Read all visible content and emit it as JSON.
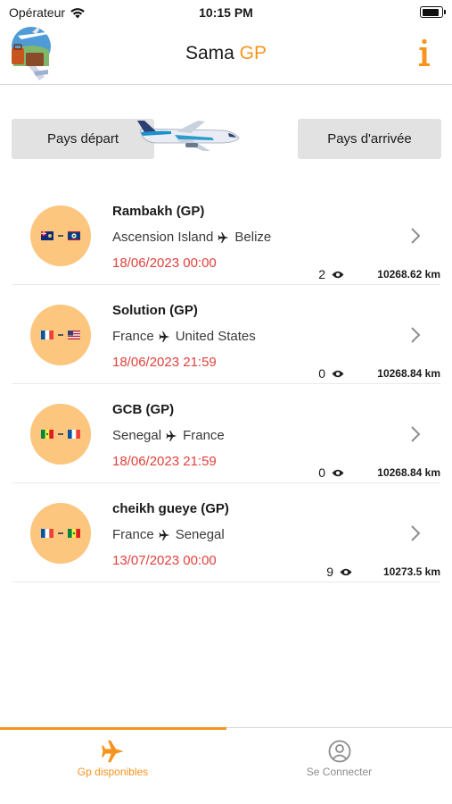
{
  "status_bar": {
    "carrier": "Opérateur",
    "time": "10:15 PM",
    "battery_level": 0.9
  },
  "header": {
    "title_main": "Sama",
    "title_accent": "GP"
  },
  "filters": {
    "departure_label": "Pays départ",
    "arrival_label": "Pays d'arrivée"
  },
  "listings": [
    {
      "name": "Rambakh (GP)",
      "from": "Ascension Island",
      "to": "Belize",
      "date": "18/06/2023 00:00",
      "views": "2",
      "distance": "10268.62 km",
      "from_flag": "flag-ascension-island",
      "to_flag": "flag-belize"
    },
    {
      "name": "Solution (GP)",
      "from": "France",
      "to": "United States",
      "date": "18/06/2023 21:59",
      "views": "0",
      "distance": "10268.84 km",
      "from_flag": "flag-france",
      "to_flag": "flag-united-states"
    },
    {
      "name": "GCB (GP)",
      "from": "Senegal",
      "to": "France",
      "date": "18/06/2023 21:59",
      "views": "0",
      "distance": "10268.84 km",
      "from_flag": "flag-senegal",
      "to_flag": "flag-france"
    },
    {
      "name": "cheikh gueye (GP)",
      "from": "France",
      "to": "Senegal",
      "date": "13/07/2023 00:00",
      "views": "9",
      "distance": "10273.5 km",
      "from_flag": "flag-france",
      "to_flag": "flag-senegal"
    }
  ],
  "tabs": [
    {
      "label": "Gp disponibles",
      "icon": "airplane-icon",
      "active": true
    },
    {
      "label": "Se Connecter",
      "icon": "user-circle-icon",
      "active": false
    }
  ],
  "colors": {
    "accent": "#f7941d",
    "date_red": "#e2413b",
    "avatar_bg": "#fcc67f",
    "button_bg": "#e2e2e2"
  }
}
